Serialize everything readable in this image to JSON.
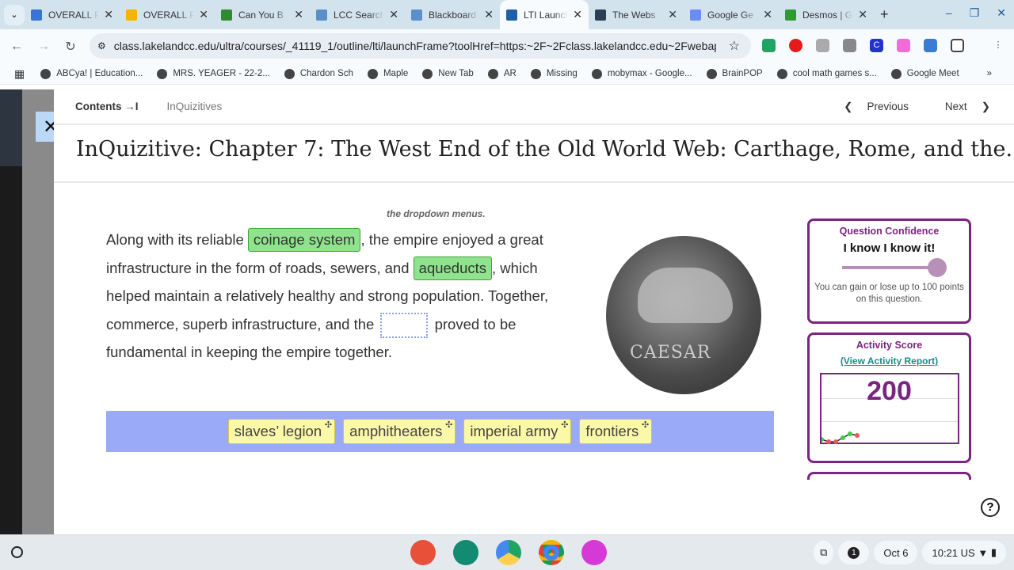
{
  "browser": {
    "tabs": [
      {
        "label": "OVERALL P",
        "color": "#3a73d8"
      },
      {
        "label": "OVERALL P",
        "color": "#f4b400"
      },
      {
        "label": "Can You B",
        "color": "#2e8b2e"
      },
      {
        "label": "LCC Search",
        "color": "#5a8fc7"
      },
      {
        "label": "Blackboard",
        "color": "#5a8fc7"
      },
      {
        "label": "LTI Launch",
        "color": "#1d5fa8"
      },
      {
        "label": "The Webs",
        "color": "#2d3e55"
      },
      {
        "label": "Google Ge",
        "color": "#6b8cf5"
      },
      {
        "label": "Desmos | G",
        "color": "#2e9b2e"
      }
    ],
    "url": "class.lakelandcc.edu/ultra/courses/_41119_1/outline/lti/launchFrame?toolHref=https:~2F~2Fclass.lakelandcc.edu~2Fwebapp...",
    "bookmarks": [
      "ABCya! | Education...",
      "MRS. YEAGER - 22-2...",
      "Chardon Sch",
      "Maple",
      "New Tab",
      "AR",
      "Missing",
      "mobymax - Google...",
      "BrainPOP",
      "cool math games s...",
      "Google Meet"
    ]
  },
  "header": {
    "contents": "Contents →I",
    "breadcrumb": "InQuizitives",
    "previous": "Previous",
    "next": "Next"
  },
  "title": "InQuizitive: Chapter 7: The West End of the Old World Web: Carthage, Rome, and the...",
  "question": {
    "instruction": "the dropdown menus.",
    "t1": "Along with its reliable ",
    "a1": "coinage system",
    "t2": ", the empire enjoyed a great infrastructure in the form of roads, sewers, and ",
    "a2": "aqueducts",
    "t3": ", which helped maintain a relatively healthy and strong population. Together, commerce, superb infrastructure, and the ",
    "t4": " proved to be fundamental in keeping the empire together.",
    "coin_legend": "CAESAR",
    "options": [
      "slaves’ legion",
      "amphitheaters",
      "imperial army",
      "frontiers"
    ]
  },
  "confidence": {
    "title": "Question Confidence",
    "value": "I know I know it!",
    "level": 1.0,
    "note": "You can gain or lose up to 100 points on this question."
  },
  "activity": {
    "title": "Activity Score",
    "link": "(View Activity Report)",
    "score": "200"
  },
  "taskbar": {
    "notifications": "1",
    "date": "Oct 6",
    "time": "10:21",
    "locale": "US"
  }
}
